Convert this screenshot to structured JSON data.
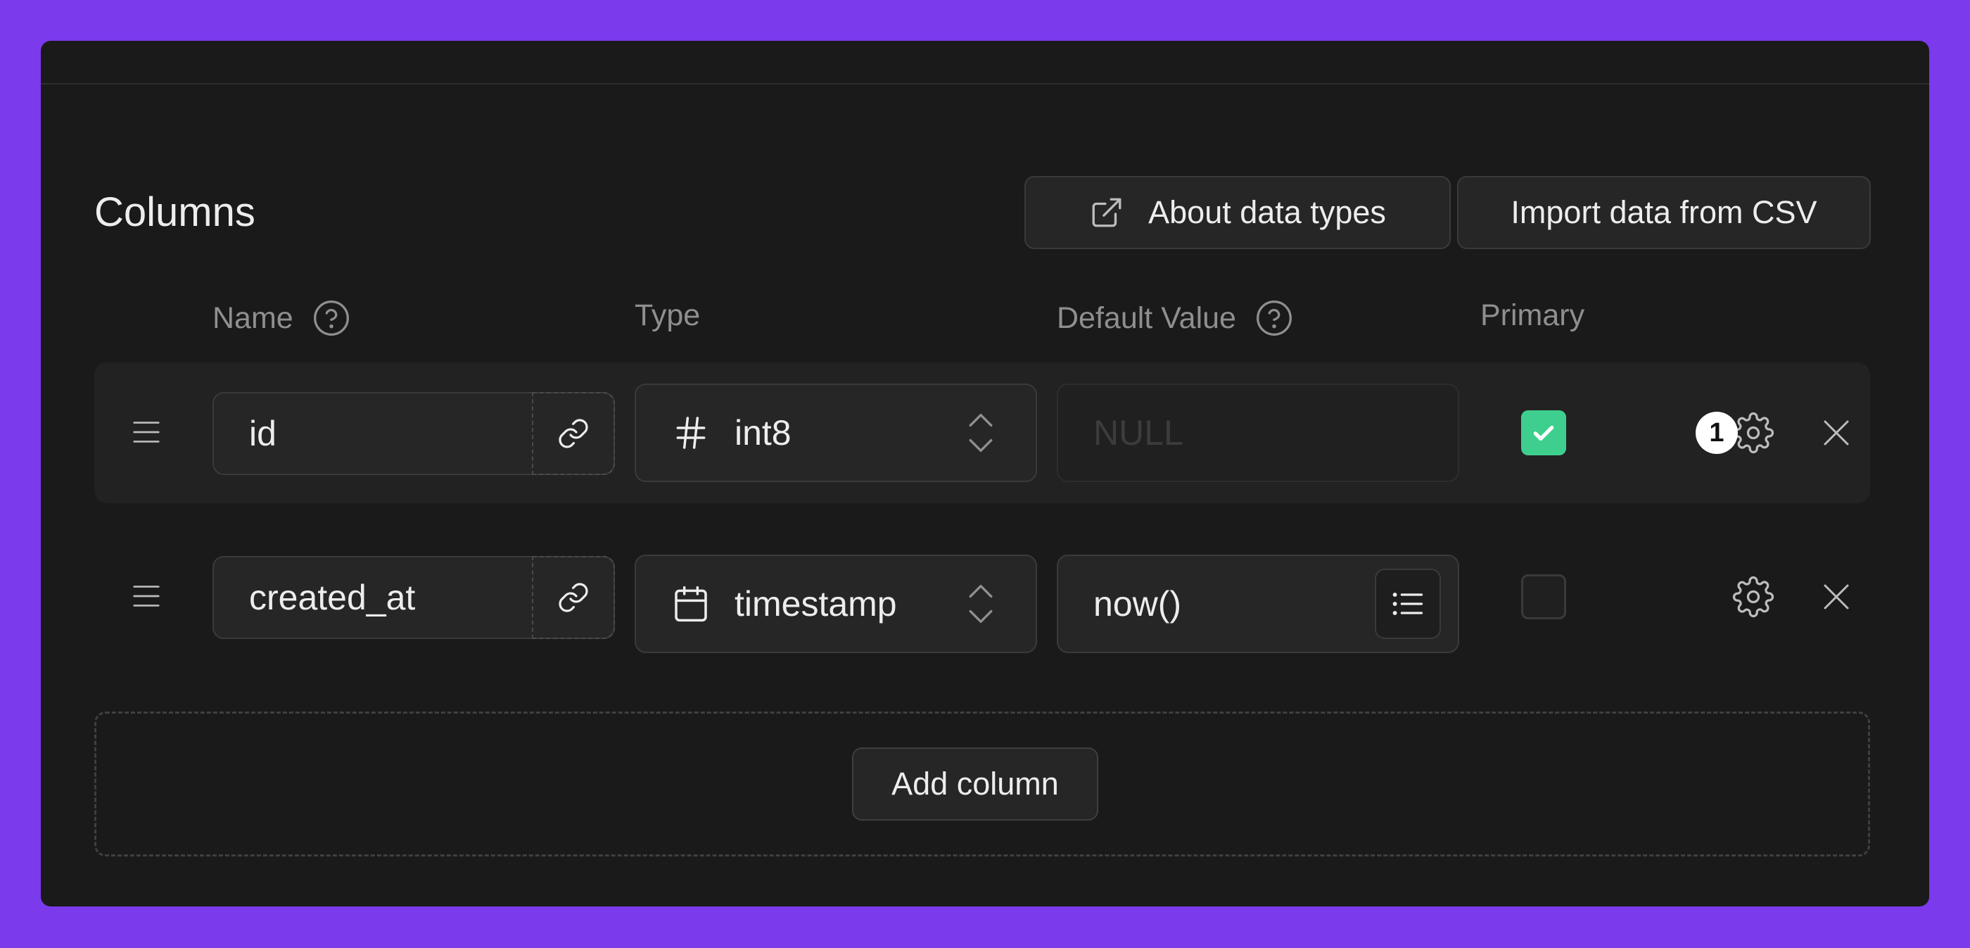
{
  "header": {
    "title": "Columns",
    "about_label": "About data types",
    "import_label": "Import data from CSV"
  },
  "columns_header": {
    "name": "Name",
    "type": "Type",
    "default_value": "Default Value",
    "primary": "Primary"
  },
  "rows": [
    {
      "name": "id",
      "type_icon": "hash-icon",
      "type": "int8",
      "default_value": "",
      "default_placeholder": "NULL",
      "primary": true,
      "badge": "1"
    },
    {
      "name": "created_at",
      "type_icon": "calendar-icon",
      "type": "timestamp",
      "default_value": "now()",
      "primary": false
    }
  ],
  "add_label": "Add column",
  "colors": {
    "background": "#7c3aed",
    "panel": "#1a1a1a",
    "accent": "#3ecf8e"
  }
}
